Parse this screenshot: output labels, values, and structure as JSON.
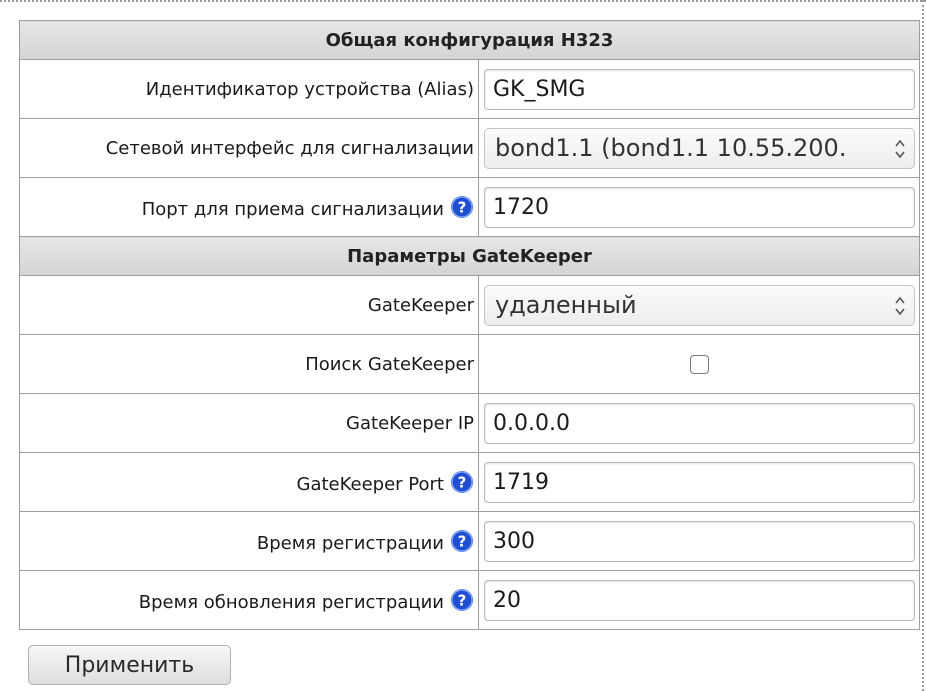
{
  "sections": {
    "general": {
      "title": "Общая конфигурация H323"
    },
    "gatekeeper": {
      "title": "Параметры GateKeeper"
    }
  },
  "fields": {
    "alias": {
      "label": "Идентификатор устройства (Alias)",
      "value": "GK_SMG"
    },
    "signal_iface": {
      "label": "Сетевой интерфейс для сигнализации",
      "value": "bond1.1 (bond1.1 10.55.200."
    },
    "signal_port": {
      "label": "Порт для приема сигнализации",
      "value": "1720",
      "help": true
    },
    "gatekeeper_mode": {
      "label": "GateKeeper",
      "value": "удаленный"
    },
    "gatekeeper_search": {
      "label": "Поиск GateKeeper",
      "checked": false
    },
    "gatekeeper_ip": {
      "label": "GateKeeper IP",
      "value": "0.0.0.0"
    },
    "gatekeeper_port": {
      "label": "GateKeeper Port",
      "value": "1719",
      "help": true
    },
    "reg_time": {
      "label": "Время регистрации",
      "value": "300",
      "help": true
    },
    "reg_update_time": {
      "label": "Время обновления регистрации",
      "value": "20",
      "help": true
    }
  },
  "apply_button": {
    "label": "Применить"
  },
  "icons": {
    "help": "question-circle-icon",
    "select_arrows": "updown-arrows-icon"
  },
  "colors": {
    "help_icon": "#1f4fd0",
    "section_bg": "#dcdcdc",
    "border": "#9e9e9e"
  }
}
